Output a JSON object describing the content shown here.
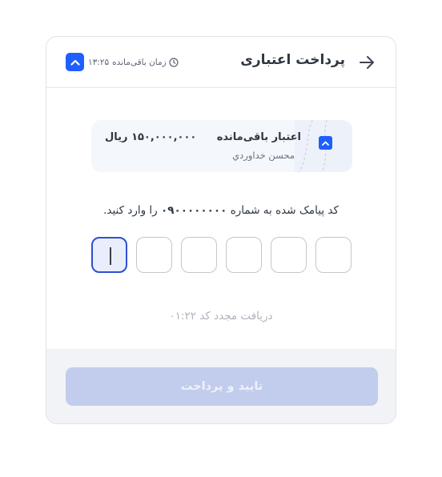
{
  "header": {
    "title": "پرداخت اعتباری",
    "timer_label": "زمان باقی‌مانده",
    "timer_value": "۱۳:۲۵"
  },
  "credit": {
    "label": "اعتبار باقی‌مانده",
    "owner": "محسن خداوردي",
    "amount": "۱۵۰,۰۰۰,۰۰۰ ریال"
  },
  "sms": {
    "prefix": "کد پیامک شده به شماره",
    "phone": "۰۹۰۰۰۰۰۰۰۰",
    "suffix": "را وارد کنید."
  },
  "otp": {
    "digits": [
      "",
      "",
      "",
      "",
      "",
      ""
    ],
    "active_index": 5
  },
  "resend": {
    "label": "دریافت مجدد کد",
    "countdown": "۰۱:۲۲"
  },
  "submit": {
    "label": "تایید و پرداخت"
  },
  "colors": {
    "accent": "#1f5eff",
    "active_box_border": "#2f4fd1",
    "button_disabled": "#c2ccec"
  }
}
